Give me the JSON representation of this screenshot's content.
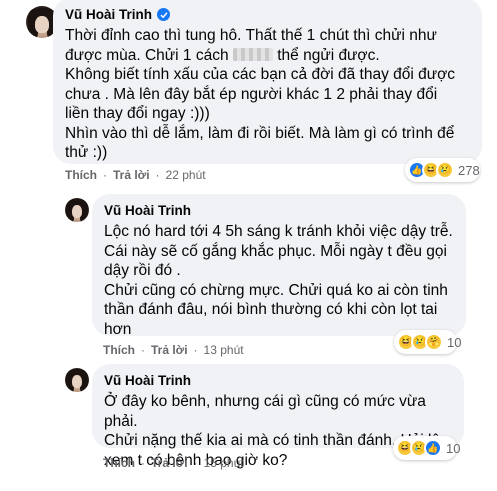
{
  "comments": [
    {
      "author": "Vũ Hoài Trinh",
      "lines": [
        "Thời đỉnh cao thì tung hô. Thất thế 1 chút thì chửi như",
        "được mùa. Chửi 1 cách",
        "thể ngửi được.",
        "Không biết tính xấu của các bạn cả đời đã thay đổi được",
        "chưa . Mà lên đây bắt ép người khác 1 2 phải thay đổi",
        "liền thay đổi ngay :)))",
        "Nhìn vào thì dễ lắm, làm đi rồi biết. Mà làm gì có trình để",
        "thử :))"
      ],
      "like_label": "Thích",
      "reply_label": "Trả lời",
      "time": "22 phút",
      "reaction_icons": [
        "like-icon",
        "haha-icon",
        "sad-icon"
      ],
      "reaction_count": "278"
    },
    {
      "author": "Vũ Hoài Trinh",
      "lines": [
        "Lộc nó hard tới 4 5h sáng k tránh khỏi việc dậy trễ.",
        "Cái này sẽ cố gắng khắc phục. Mỗi ngày t đều gọi",
        "dậy rồi đó .",
        "Chửi cũng có chừng mực. Chửi quá ko ai còn tinh",
        "thần đánh đâu, nói bình thường có khi còn lọt tai",
        "hơn"
      ],
      "like_label": "Thích",
      "reply_label": "Trả lời",
      "time": "13 phút",
      "reaction_icons": [
        "haha-icon",
        "sad-icon",
        "care-icon"
      ],
      "reaction_count": "10"
    },
    {
      "author": "Vũ Hoài Trinh",
      "lines": [
        "Ở đây ko bênh, nhưng cái gì cũng có mức vừa phải.",
        "Chửi nặng thế kia ai mà có tinh thần đánh. Hỏi lộc",
        "xem t có bênh bao giờ ko?"
      ],
      "like_label": "Thích",
      "reply_label": "Trả lời",
      "time": "15 phút",
      "reaction_icons": [
        "haha-icon",
        "sad-icon",
        "like-icon"
      ],
      "reaction_count": "10"
    }
  ],
  "separator": "·",
  "colors": {
    "bubble": "#f0f2f5",
    "meta": "#65676b",
    "verified": "#1877f2"
  }
}
